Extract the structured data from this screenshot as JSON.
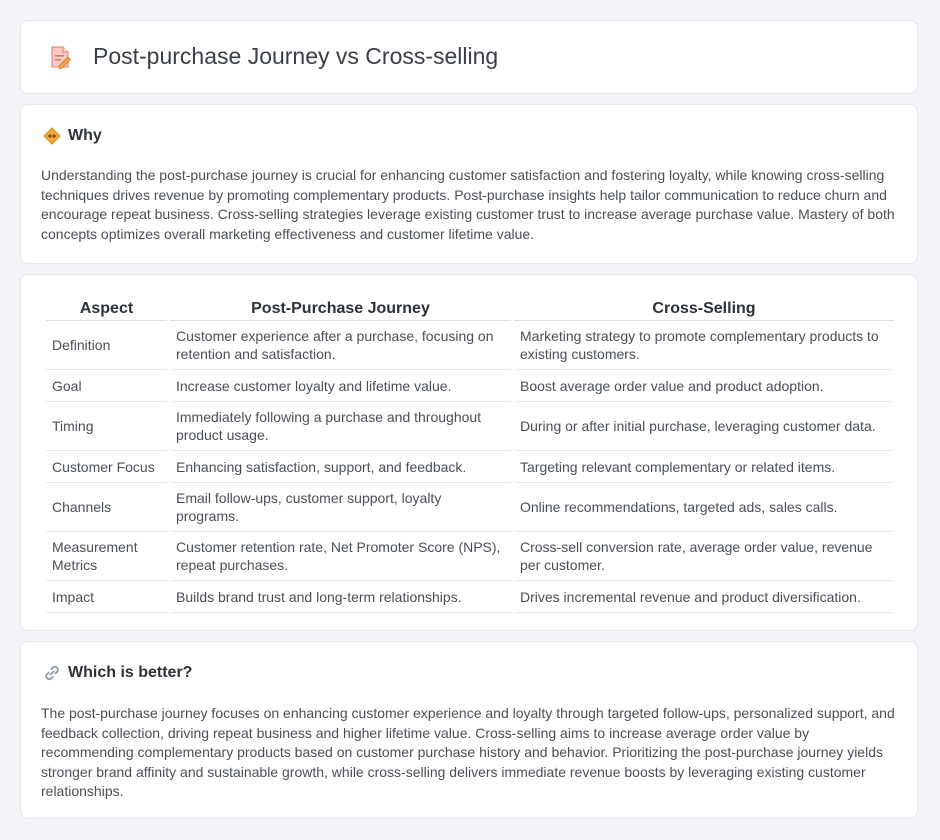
{
  "header": {
    "title": "Post-purchase Journey vs Cross-selling",
    "icon": "document-edit-icon"
  },
  "why": {
    "title": "Why",
    "icon": "diamond-sign-icon",
    "text": "Understanding the post-purchase journey is crucial for enhancing customer satisfaction and fostering loyalty, while knowing cross-selling techniques drives revenue by promoting complementary products. Post-purchase insights help tailor communication to reduce churn and encourage repeat business. Cross-selling strategies leverage existing customer trust to increase average purchase value. Mastery of both concepts optimizes overall marketing effectiveness and customer lifetime value."
  },
  "comparison": {
    "headers": [
      "Aspect",
      "Post-Purchase Journey",
      "Cross-Selling"
    ],
    "rows": [
      {
        "aspect": "Definition",
        "post": "Customer experience after a purchase, focusing on retention and satisfaction.",
        "cross": "Marketing strategy to promote complementary products to existing customers."
      },
      {
        "aspect": "Goal",
        "post": "Increase customer loyalty and lifetime value.",
        "cross": "Boost average order value and product adoption."
      },
      {
        "aspect": "Timing",
        "post": "Immediately following a purchase and throughout product usage.",
        "cross": "During or after initial purchase, leveraging customer data."
      },
      {
        "aspect": "Customer Focus",
        "post": "Enhancing satisfaction, support, and feedback.",
        "cross": "Targeting relevant complementary or related items."
      },
      {
        "aspect": "Channels",
        "post": "Email follow-ups, customer support, loyalty programs.",
        "cross": "Online recommendations, targeted ads, sales calls."
      },
      {
        "aspect": "Measurement Metrics",
        "post": "Customer retention rate, Net Promoter Score (NPS), repeat purchases.",
        "cross": "Cross-sell conversion rate, average order value, revenue per customer."
      },
      {
        "aspect": "Impact",
        "post": "Builds brand trust and long-term relationships.",
        "cross": "Drives incremental revenue and product diversification."
      }
    ]
  },
  "better": {
    "title": "Which is better?",
    "icon": "link-icon",
    "text": "The post-purchase journey focuses on enhancing customer experience and loyalty through targeted follow-ups, personalized support, and feedback collection, driving repeat business and higher lifetime value. Cross-selling aims to increase average order value by recommending complementary products based on customer purchase history and behavior. Prioritizing the post-purchase journey yields stronger brand affinity and sustainable growth, while cross-selling delivers immediate revenue boosts by leveraging existing customer relationships."
  }
}
